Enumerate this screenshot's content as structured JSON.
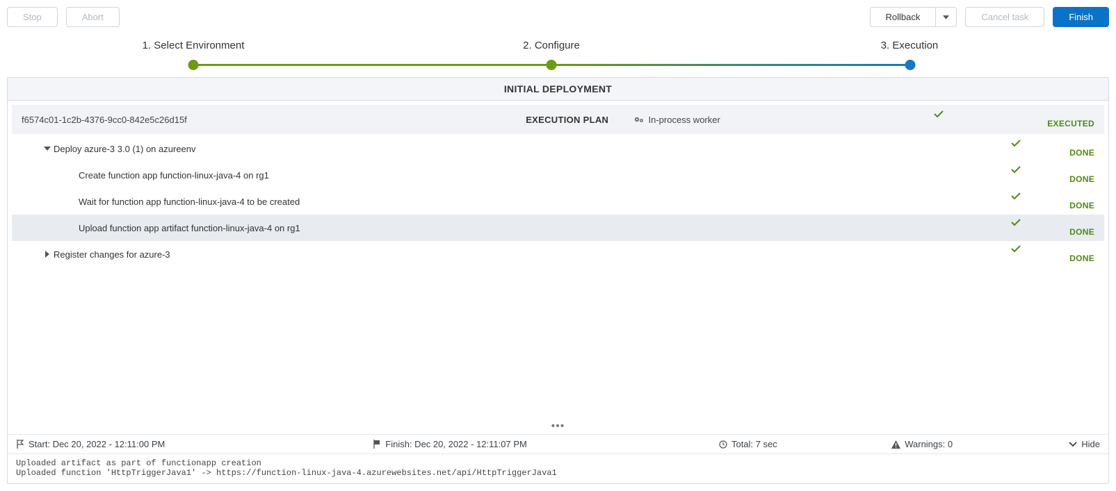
{
  "toolbar": {
    "stop": "Stop",
    "abort": "Abort",
    "rollback": "Rollback",
    "cancel": "Cancel task",
    "finish": "Finish"
  },
  "steps": {
    "s1": "1. Select Environment",
    "s2": "2. Configure",
    "s3": "3. Execution"
  },
  "panel": {
    "title": "INITIAL DEPLOYMENT"
  },
  "plan": {
    "id": "f6574c01-1c2b-4376-9cc0-842e5c26d15f",
    "center": "EXECUTION PLAN",
    "worker": "In-process worker",
    "status": "EXECUTED"
  },
  "rows": [
    {
      "label": "Deploy azure-3 3.0 (1) on azureenv",
      "status": "DONE",
      "caret": "down",
      "indent": 0
    },
    {
      "label": "Create function app function-linux-java-4 on rg1",
      "status": "DONE",
      "caret": "none",
      "indent": 1
    },
    {
      "label": "Wait for function app function-linux-java-4 to be created",
      "status": "DONE",
      "caret": "none",
      "indent": 1
    },
    {
      "label": "Upload function app artifact function-linux-java-4 on rg1",
      "status": "DONE",
      "caret": "none",
      "indent": 1,
      "highlight": true
    },
    {
      "label": "Register changes for azure-3",
      "status": "DONE",
      "caret": "right",
      "indent": 0
    }
  ],
  "meta": {
    "start": "Start: Dec 20, 2022 - 12:11:00 PM",
    "finish": "Finish: Dec 20, 2022 - 12:11:07 PM",
    "total": "Total: 7 sec",
    "warnings": "Warnings: 0",
    "hide": "Hide"
  },
  "log": "Uploaded artifact as part of functionapp creation\nUploaded function 'HttpTriggerJava1' -> https://function-linux-java-4.azurewebsites.net/api/HttpTriggerJava1"
}
